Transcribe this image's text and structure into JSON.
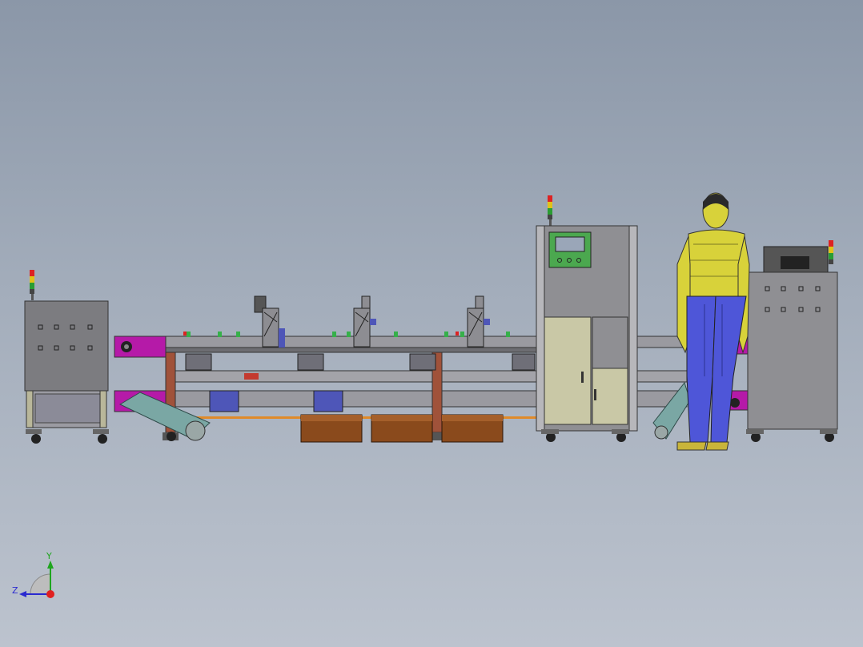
{
  "viewport": {
    "title": "",
    "background_top": "#8b97a8",
    "background_bottom": "#bcc3ce"
  },
  "triad": {
    "y_label": "Y",
    "z_label": "Z",
    "y_color": "#1fa51f",
    "z_color": "#2a2ad0",
    "x_color": "#e02020"
  },
  "model": {
    "frame_color": "#8f8f93",
    "panel_color": "#7c7c80",
    "cabinet_door_color": "#c9c8a6",
    "accent_magenta": "#b51aa8",
    "accent_green": "#36b04a",
    "roller_color": "#8a4a1c",
    "operator_shirt": "#d8d23a",
    "operator_pants": "#4e56d8"
  }
}
